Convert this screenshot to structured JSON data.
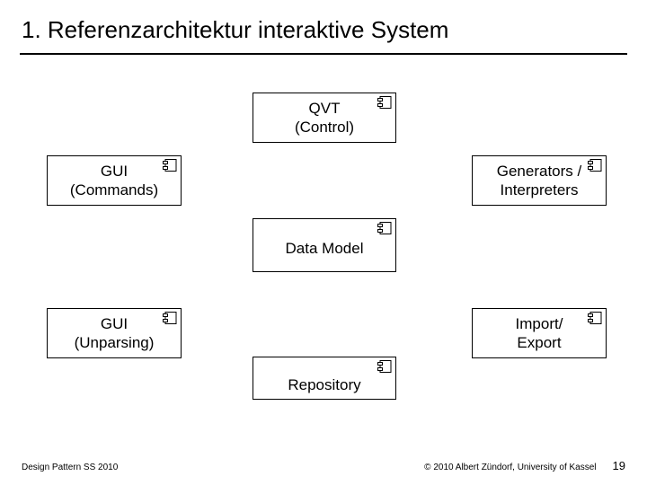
{
  "title": "1. Referenzarchitektur interaktive System",
  "components": {
    "qvt": {
      "label": "QVT\n(Control)"
    },
    "gui_commands": {
      "label": "GUI\n(Commands)"
    },
    "generators": {
      "label": "Generators /\nInterpreters"
    },
    "data_model": {
      "label": "Data Model"
    },
    "gui_unparsing": {
      "label": "GUI\n(Unparsing)"
    },
    "import_export": {
      "label": "Import/\nExport"
    },
    "repository": {
      "label": "Repository"
    }
  },
  "footer": {
    "left": "Design Pattern SS 2010",
    "right": "© 2010 Albert Zündorf, University of Kassel",
    "page": "19"
  }
}
